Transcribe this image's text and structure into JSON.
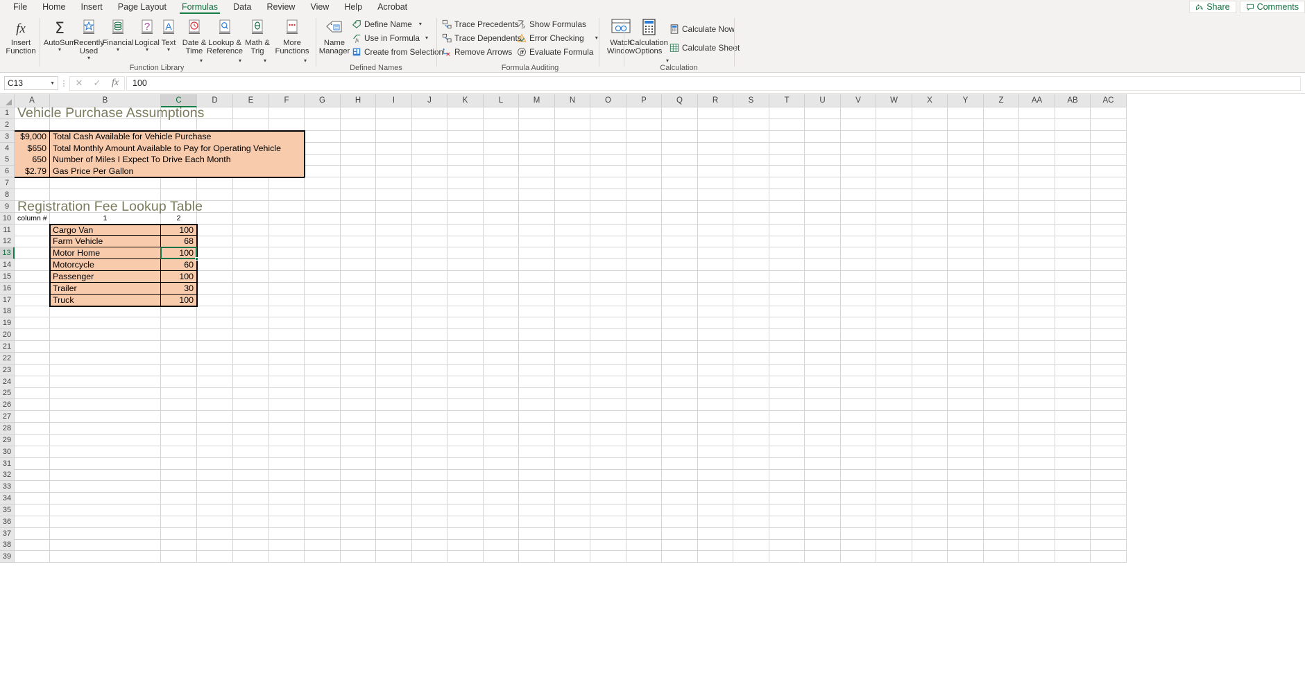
{
  "app": {
    "tabs": [
      {
        "label": "File",
        "active": false
      },
      {
        "label": "Home",
        "active": false
      },
      {
        "label": "Insert",
        "active": false
      },
      {
        "label": "Page Layout",
        "active": false
      },
      {
        "label": "Formulas",
        "active": true
      },
      {
        "label": "Data",
        "active": false
      },
      {
        "label": "Review",
        "active": false
      },
      {
        "label": "View",
        "active": false
      },
      {
        "label": "Help",
        "active": false
      },
      {
        "label": "Acrobat",
        "active": false
      }
    ],
    "share_label": "Share",
    "comments_label": "Comments"
  },
  "ribbon": {
    "groups": [
      {
        "name": "Function Library",
        "label": "Function Library"
      },
      {
        "name": "Defined Names",
        "label": "Defined Names"
      },
      {
        "name": "Formula Auditing",
        "label": "Formula Auditing"
      },
      {
        "name": "Calculation",
        "label": "Calculation"
      }
    ],
    "function_library": {
      "insert_function": "Insert\nFunction",
      "autosum": "AutoSum",
      "recently_used": "Recently\nUsed",
      "financial": "Financial",
      "logical": "Logical",
      "text": "Text",
      "date_time": "Date &\nTime",
      "lookup_reference": "Lookup &\nReference",
      "math_trig": "Math &\nTrig",
      "more_functions": "More\nFunctions"
    },
    "defined_names": {
      "name_manager": "Name\nManager",
      "define_name": "Define Name",
      "use_in_formula": "Use in Formula",
      "create_from_selection": "Create from Selection"
    },
    "formula_auditing": {
      "trace_precedents": "Trace Precedents",
      "trace_dependents": "Trace Dependents",
      "remove_arrows": "Remove Arrows",
      "show_formulas": "Show Formulas",
      "error_checking": "Error Checking",
      "evaluate_formula": "Evaluate Formula",
      "watch_window": "Watch\nWindow"
    },
    "calculation": {
      "calculation_options": "Calculation\nOptions",
      "calculate_now": "Calculate Now",
      "calculate_sheet": "Calculate Sheet"
    }
  },
  "formula_bar": {
    "name_box_value": "C13",
    "formula_value": "100"
  },
  "grid": {
    "columns": [
      "A",
      "B",
      "C",
      "D",
      "E",
      "F",
      "G",
      "H",
      "I",
      "J",
      "K",
      "L",
      "M",
      "N",
      "O",
      "P",
      "Q",
      "R",
      "S",
      "T",
      "U",
      "V",
      "W",
      "X",
      "Y",
      "Z",
      "AA",
      "AB",
      "AC"
    ],
    "selected_column": "C",
    "selected_row": "13",
    "rows": [
      "1",
      "2",
      "3",
      "4",
      "5",
      "6",
      "7",
      "8",
      "9",
      "10",
      "11",
      "12",
      "13",
      "14",
      "15",
      "16",
      "17",
      "18",
      "19",
      "20",
      "21",
      "22",
      "23",
      "24",
      "25",
      "26",
      "27",
      "28",
      "29",
      "30",
      "31",
      "32",
      "33",
      "34",
      "35",
      "36",
      "37",
      "38",
      "39"
    ]
  },
  "sheet": {
    "title_1": "Vehicle Purchase Assumptions",
    "title_2": "Registration Fee Lookup Table",
    "assumptions": [
      {
        "row": "3",
        "value": "$9,000",
        "label": "Total Cash Available for Vehicle Purchase"
      },
      {
        "row": "4",
        "value": "$650",
        "label": "Total Monthly Amount Available to Pay for Operating Vehicle"
      },
      {
        "row": "5",
        "value": "650",
        "label": "Number of Miles I Expect To Drive Each Month"
      },
      {
        "row": "6",
        "value": "$2.79",
        "label": "Gas Price Per Gallon"
      }
    ],
    "lookup_header": {
      "label": "column #",
      "col1": "1",
      "col2": "2"
    },
    "lookup_rows": [
      {
        "row": "11",
        "vehicle": "Cargo Van",
        "fee": "100"
      },
      {
        "row": "12",
        "vehicle": "Farm Vehicle",
        "fee": "68"
      },
      {
        "row": "13",
        "vehicle": "Motor Home",
        "fee": "100"
      },
      {
        "row": "14",
        "vehicle": "Motorcycle",
        "fee": "60"
      },
      {
        "row": "15",
        "vehicle": "Passenger",
        "fee": "100"
      },
      {
        "row": "16",
        "vehicle": "Trailer",
        "fee": "30"
      },
      {
        "row": "17",
        "vehicle": "Truck",
        "fee": "100"
      }
    ]
  },
  "colors": {
    "accent": "#107c41",
    "fill_orange": "#f8cbad",
    "title_text": "#7b7b5e"
  }
}
